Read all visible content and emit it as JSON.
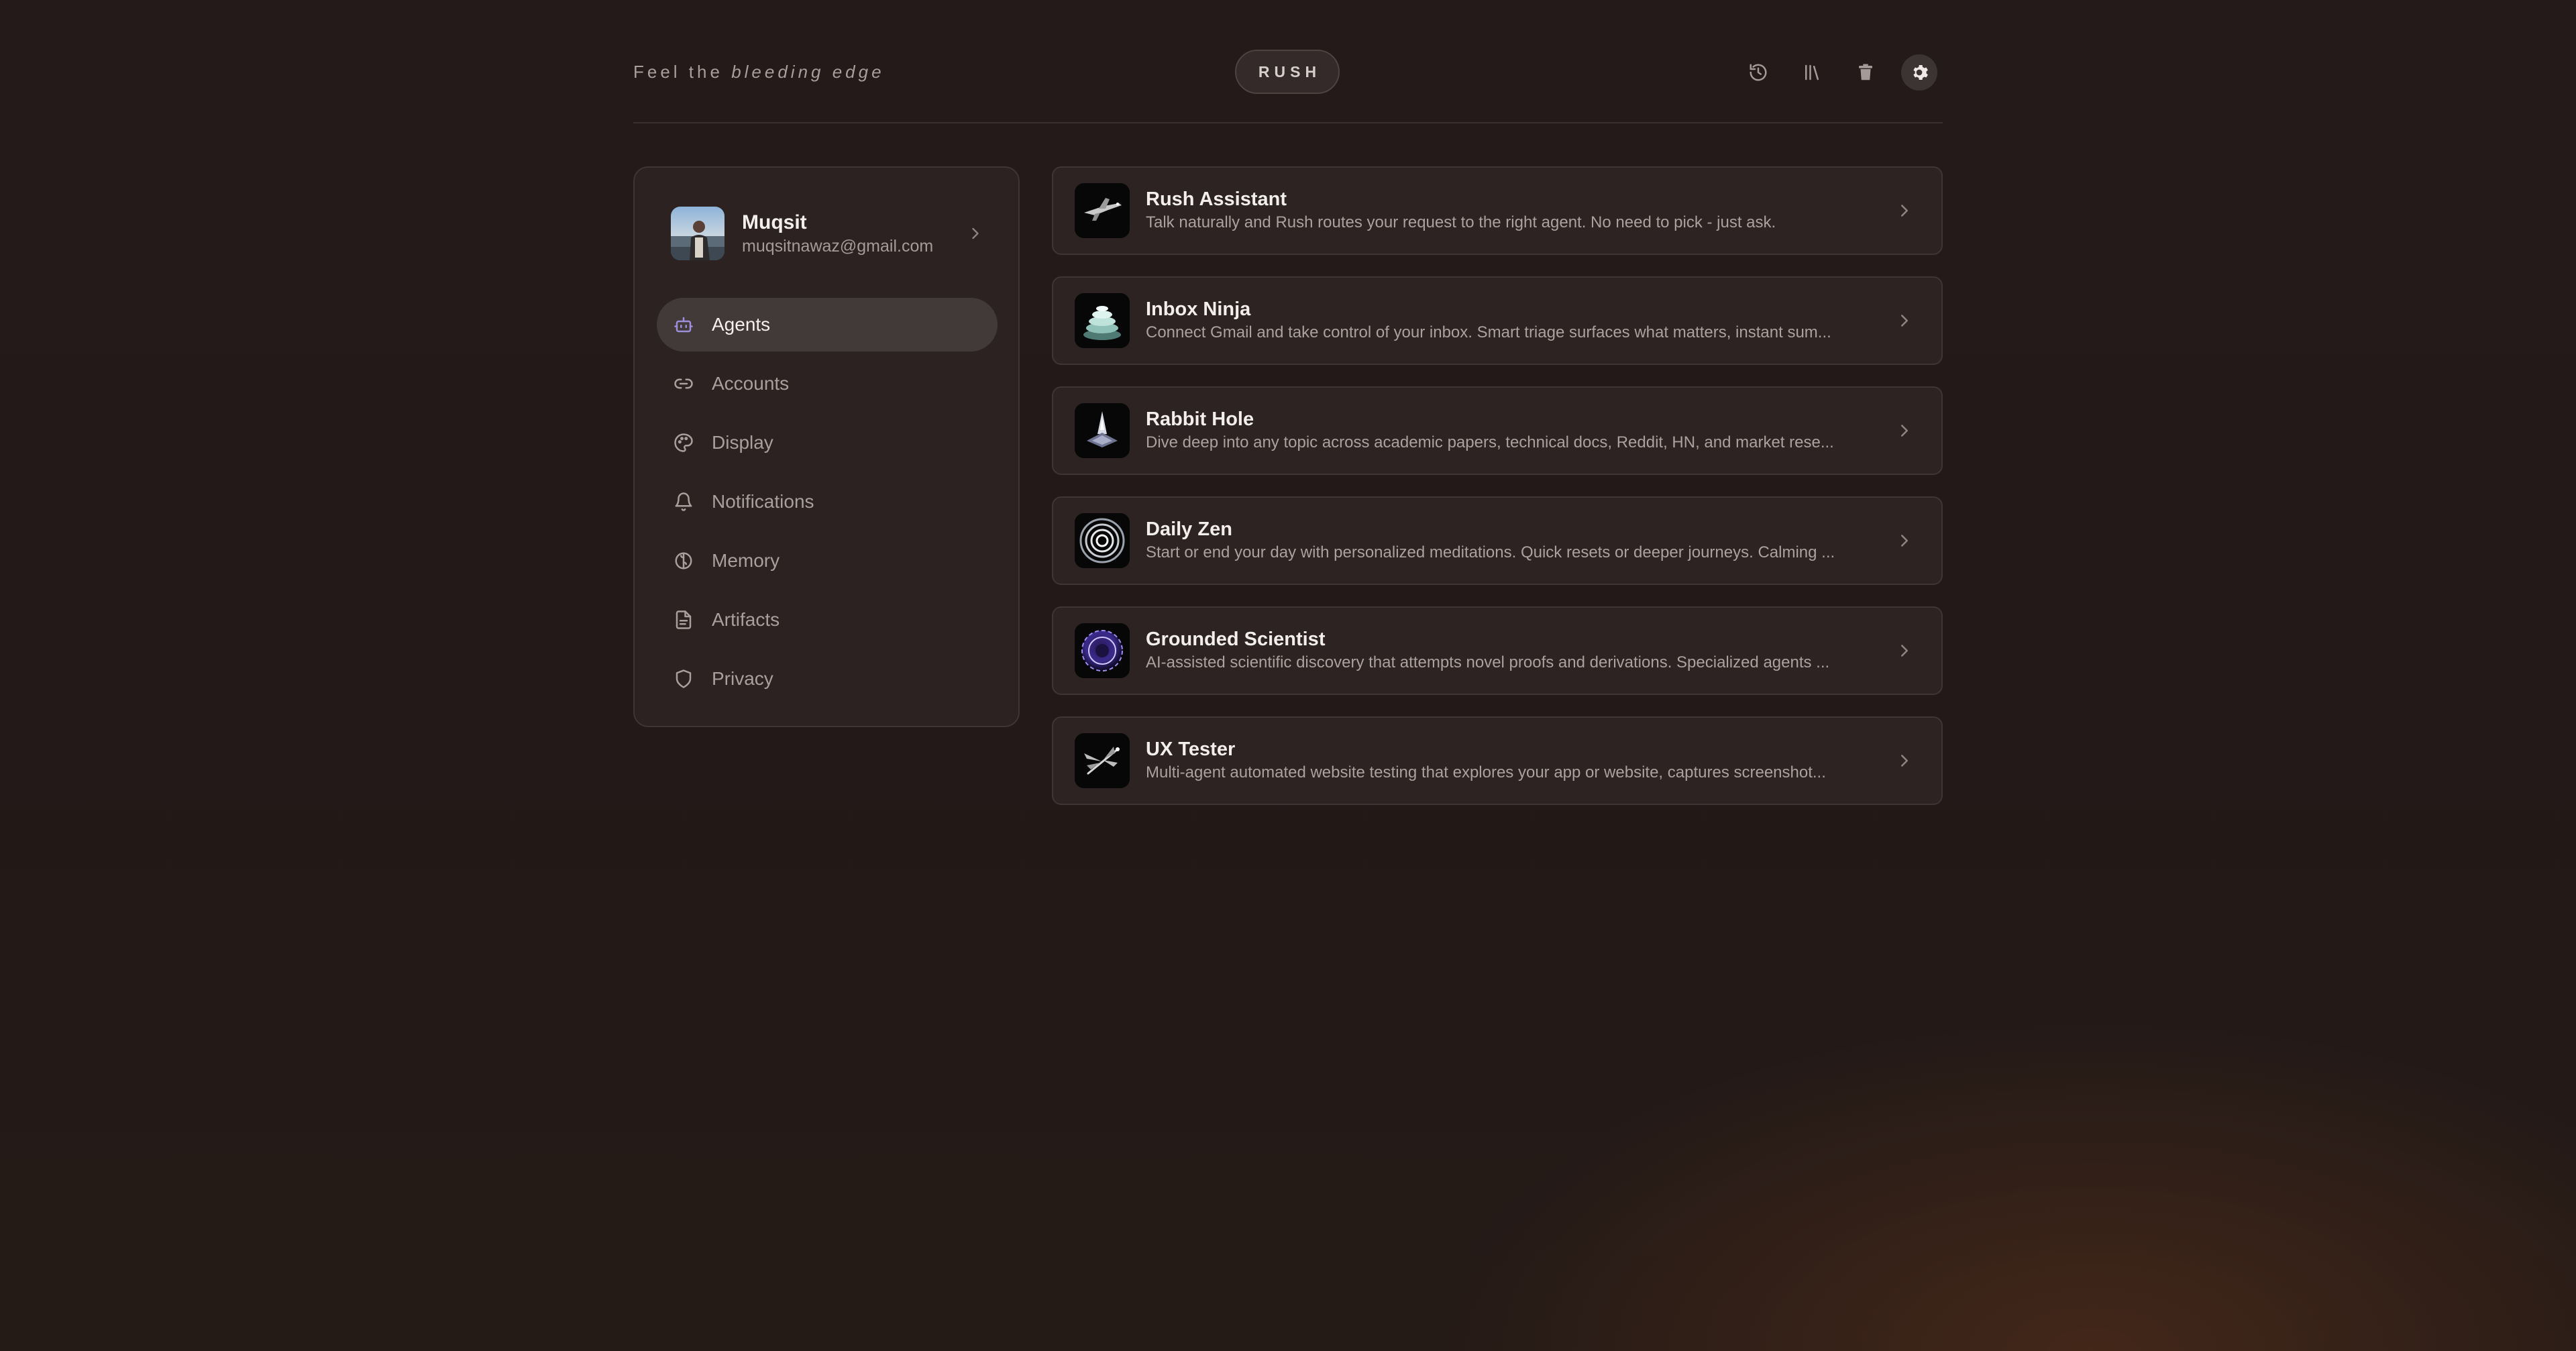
{
  "header": {
    "tagline_prefix": "Feel the",
    "tagline_emphasis": "bleeding edge",
    "brand": "RUSH",
    "icons": [
      "history-icon",
      "library-icon",
      "trash-icon",
      "settings-icon"
    ],
    "active_icon": "settings-icon"
  },
  "profile": {
    "name": "Muqsit",
    "email": "muqsitnawaz@gmail.com"
  },
  "sidebar": {
    "items": [
      {
        "label": "Agents",
        "icon": "robot-icon",
        "active": true
      },
      {
        "label": "Accounts",
        "icon": "link-icon",
        "active": false
      },
      {
        "label": "Display",
        "icon": "palette-icon",
        "active": false
      },
      {
        "label": "Notifications",
        "icon": "bell-icon",
        "active": false
      },
      {
        "label": "Memory",
        "icon": "brain-icon",
        "active": false
      },
      {
        "label": "Artifacts",
        "icon": "document-icon",
        "active": false
      },
      {
        "label": "Privacy",
        "icon": "shield-icon",
        "active": false
      }
    ]
  },
  "agents": [
    {
      "name": "Rush Assistant",
      "description": "Talk naturally and Rush routes your request to the right agent. No need to pick - just ask.",
      "icon": "plane-icon"
    },
    {
      "name": "Inbox Ninja",
      "description": "Connect Gmail and take control of your inbox. Smart triage surfaces what matters, instant sum...",
      "icon": "stack-icon"
    },
    {
      "name": "Rabbit Hole",
      "description": "Dive deep into any topic across academic papers, technical docs, Reddit, HN, and market rese...",
      "icon": "spire-icon"
    },
    {
      "name": "Daily Zen",
      "description": "Start or end your day with personalized meditations. Quick resets or deeper journeys. Calming ...",
      "icon": "rings-icon"
    },
    {
      "name": "Grounded Scientist",
      "description": "AI-assisted scientific discovery that attempts novel proofs and derivations. Specialized agents ...",
      "icon": "sphere-icon"
    },
    {
      "name": "UX Tester",
      "description": "Multi-agent automated website testing that explores your app or website, captures screenshot...",
      "icon": "dragonfly-icon"
    }
  ],
  "colors": {
    "background": "#231a19",
    "card": "#2c2322",
    "border": "#3f3534",
    "active_nav": "#423939",
    "accent": "#9a8fd8"
  }
}
